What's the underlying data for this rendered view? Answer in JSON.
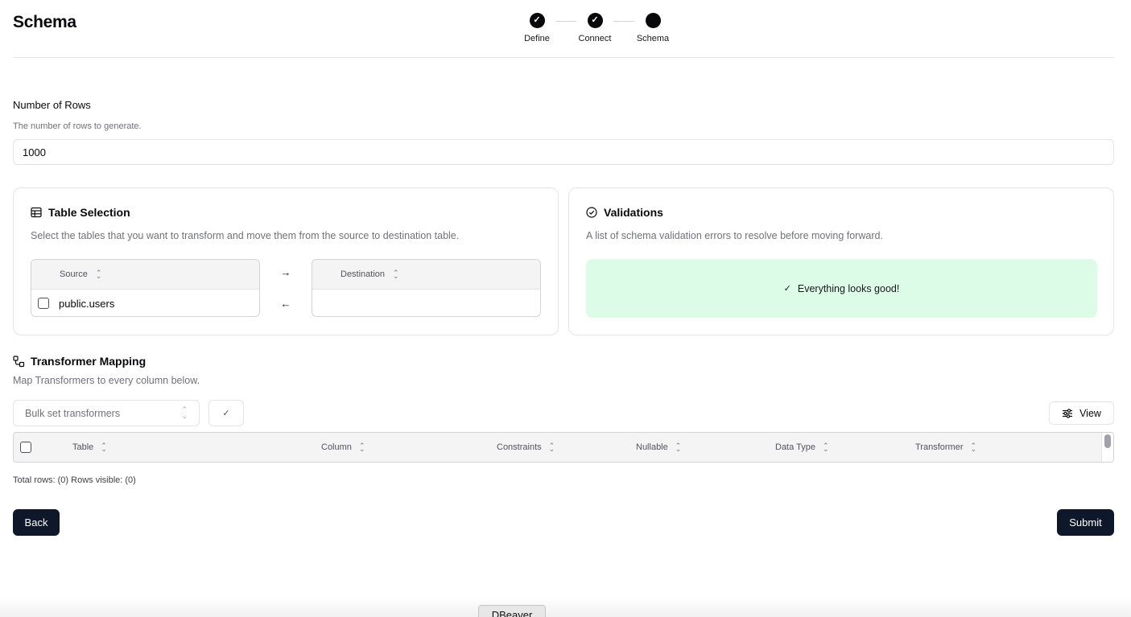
{
  "header": {
    "title": "Schema",
    "steps": [
      {
        "label": "Define",
        "state": "complete"
      },
      {
        "label": "Connect",
        "state": "complete"
      },
      {
        "label": "Schema",
        "state": "current"
      }
    ]
  },
  "rows": {
    "label": "Number of Rows",
    "description": "The number of rows to generate.",
    "value": "1000"
  },
  "table_selection": {
    "title": "Table Selection",
    "description": "Select the tables that you want to transform and move them from the source to destination table.",
    "source_header": "Source",
    "destination_header": "Destination",
    "source_items": [
      "public.users"
    ],
    "arrow_right": "→",
    "arrow_left": "←"
  },
  "validations": {
    "title": "Validations",
    "description": "A list of schema validation errors to resolve before moving forward.",
    "status_check": "✓",
    "status_text": "Everything looks good!",
    "status_color": "#dcfce7"
  },
  "transformer_mapping": {
    "title": "Transformer Mapping",
    "description": "Map Transformers to every column below.",
    "bulk_placeholder": "Bulk set transformers",
    "apply_icon": "✓",
    "view_label": "View",
    "columns": [
      "Table",
      "Column",
      "Constraints",
      "Nullable",
      "Data Type",
      "Transformer"
    ],
    "totals": "Total rows: (0) Rows visible: (0)"
  },
  "footer": {
    "back_label": "Back",
    "submit_label": "Submit"
  },
  "taskbar": {
    "app_label": "DBeaver"
  },
  "colors": {
    "primary_button": "#0f172a",
    "success_bg": "#dcfce7",
    "border": "#e4e4e7"
  }
}
